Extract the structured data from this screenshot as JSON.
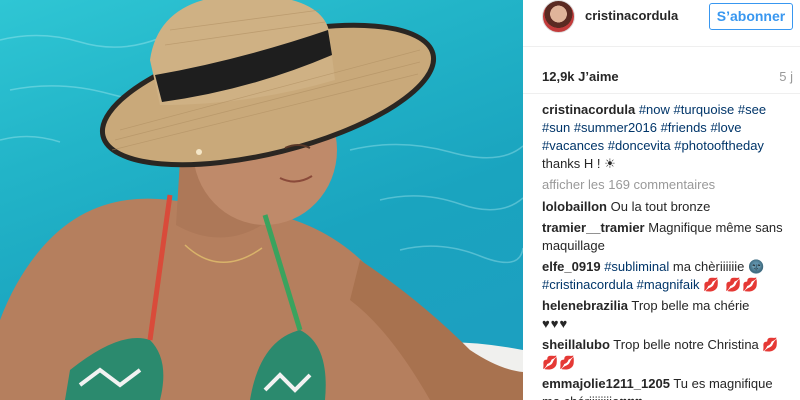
{
  "post": {
    "username": "cristinacordula",
    "follow_label": "S’abonner",
    "likes": "12,9k J’aime",
    "time": "5 j",
    "caption": {
      "user": "cristinacordula",
      "tags": [
        "#now",
        "#turquoise",
        "#see",
        "#sun",
        "#summer2016",
        "#friends",
        "#love",
        "#vacances",
        "#doncevita",
        "#photooftheday"
      ],
      "tail": "thanks H ! ☀"
    },
    "load_more": "afficher les 169 commentaires",
    "comments": [
      {
        "user": "lolobaillon",
        "text": "Ou la tout bronze"
      },
      {
        "user": "tramier__tramier",
        "text": "Magnifique même sans maquillage"
      },
      {
        "user": "elfe_0919",
        "tag1": "#subliminal",
        "text1": "ma chèriiiiiie 🌚",
        "tag2": "#cristinacordula",
        "tag3": "#magnifaik",
        "emoji": "💋 💋💋"
      },
      {
        "user": "helenebrazilia",
        "text": "Trop belle ma chérie",
        "emoji": "♥♥♥"
      },
      {
        "user": "sheillalubo",
        "text": "Trop belle notre Christina",
        "emoji": "💋 💋💋"
      },
      {
        "user": "emmajolie1211_1205",
        "text": "Tu es magnifique ma chériiiiiiiie♥♥♥"
      }
    ]
  },
  "icons": {
    "avatar": "profile-photo",
    "image": "woman-in-straw-hat-photo"
  },
  "colors": {
    "accent": "#3897f0",
    "hashtag": "#003569",
    "muted": "#999999"
  }
}
